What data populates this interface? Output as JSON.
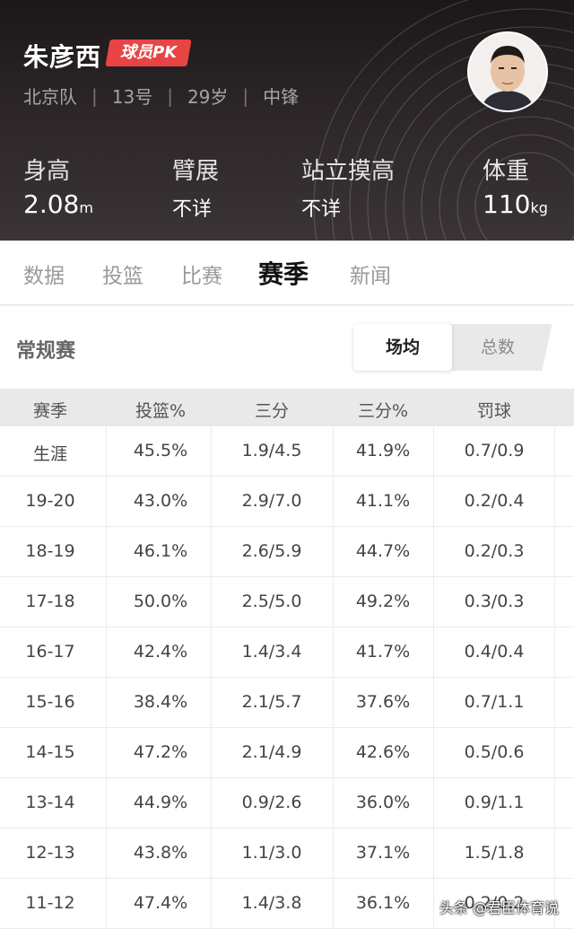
{
  "player": {
    "name": "朱彦西",
    "pk_label": "球员PK",
    "team": "北京队",
    "number": "13号",
    "age": "29岁",
    "position": "中锋"
  },
  "stats": {
    "height_label": "身高",
    "height_value": "2.08",
    "height_unit": "m",
    "wingspan_label": "臂展",
    "wingspan_value": "不详",
    "reach_label": "站立摸高",
    "reach_value": "不详",
    "weight_label": "体重",
    "weight_value": "110",
    "weight_unit": "kg"
  },
  "tabs": [
    "数据",
    "投篮",
    "比赛",
    "赛季",
    "新闻"
  ],
  "active_tab": "赛季",
  "section": {
    "title": "常规赛",
    "toggle_on": "场均",
    "toggle_off": "总数"
  },
  "table": {
    "headers": [
      "赛季",
      "投篮%",
      "三分",
      "三分%",
      "罚球"
    ],
    "rows": [
      [
        "生涯",
        "45.5%",
        "1.9/4.5",
        "41.9%",
        "0.7/0.9"
      ],
      [
        "19-20",
        "43.0%",
        "2.9/7.0",
        "41.1%",
        "0.2/0.4"
      ],
      [
        "18-19",
        "46.1%",
        "2.6/5.9",
        "44.7%",
        "0.2/0.3"
      ],
      [
        "17-18",
        "50.0%",
        "2.5/5.0",
        "49.2%",
        "0.3/0.3"
      ],
      [
        "16-17",
        "42.4%",
        "1.4/3.4",
        "41.7%",
        "0.4/0.4"
      ],
      [
        "15-16",
        "38.4%",
        "2.1/5.7",
        "37.6%",
        "0.7/1.1"
      ],
      [
        "14-15",
        "47.2%",
        "2.1/4.9",
        "42.6%",
        "0.5/0.6"
      ],
      [
        "13-14",
        "44.9%",
        "0.9/2.6",
        "36.0%",
        "0.9/1.1"
      ],
      [
        "12-13",
        "43.8%",
        "1.1/3.0",
        "37.1%",
        "1.5/1.8"
      ],
      [
        "11-12",
        "47.4%",
        "1.4/3.8",
        "36.1%",
        "0.2/0.2"
      ]
    ]
  },
  "watermark": "头条 @君臣体育说",
  "colors": {
    "header_bg": "#2a2426",
    "accent_red": "#e94444"
  }
}
